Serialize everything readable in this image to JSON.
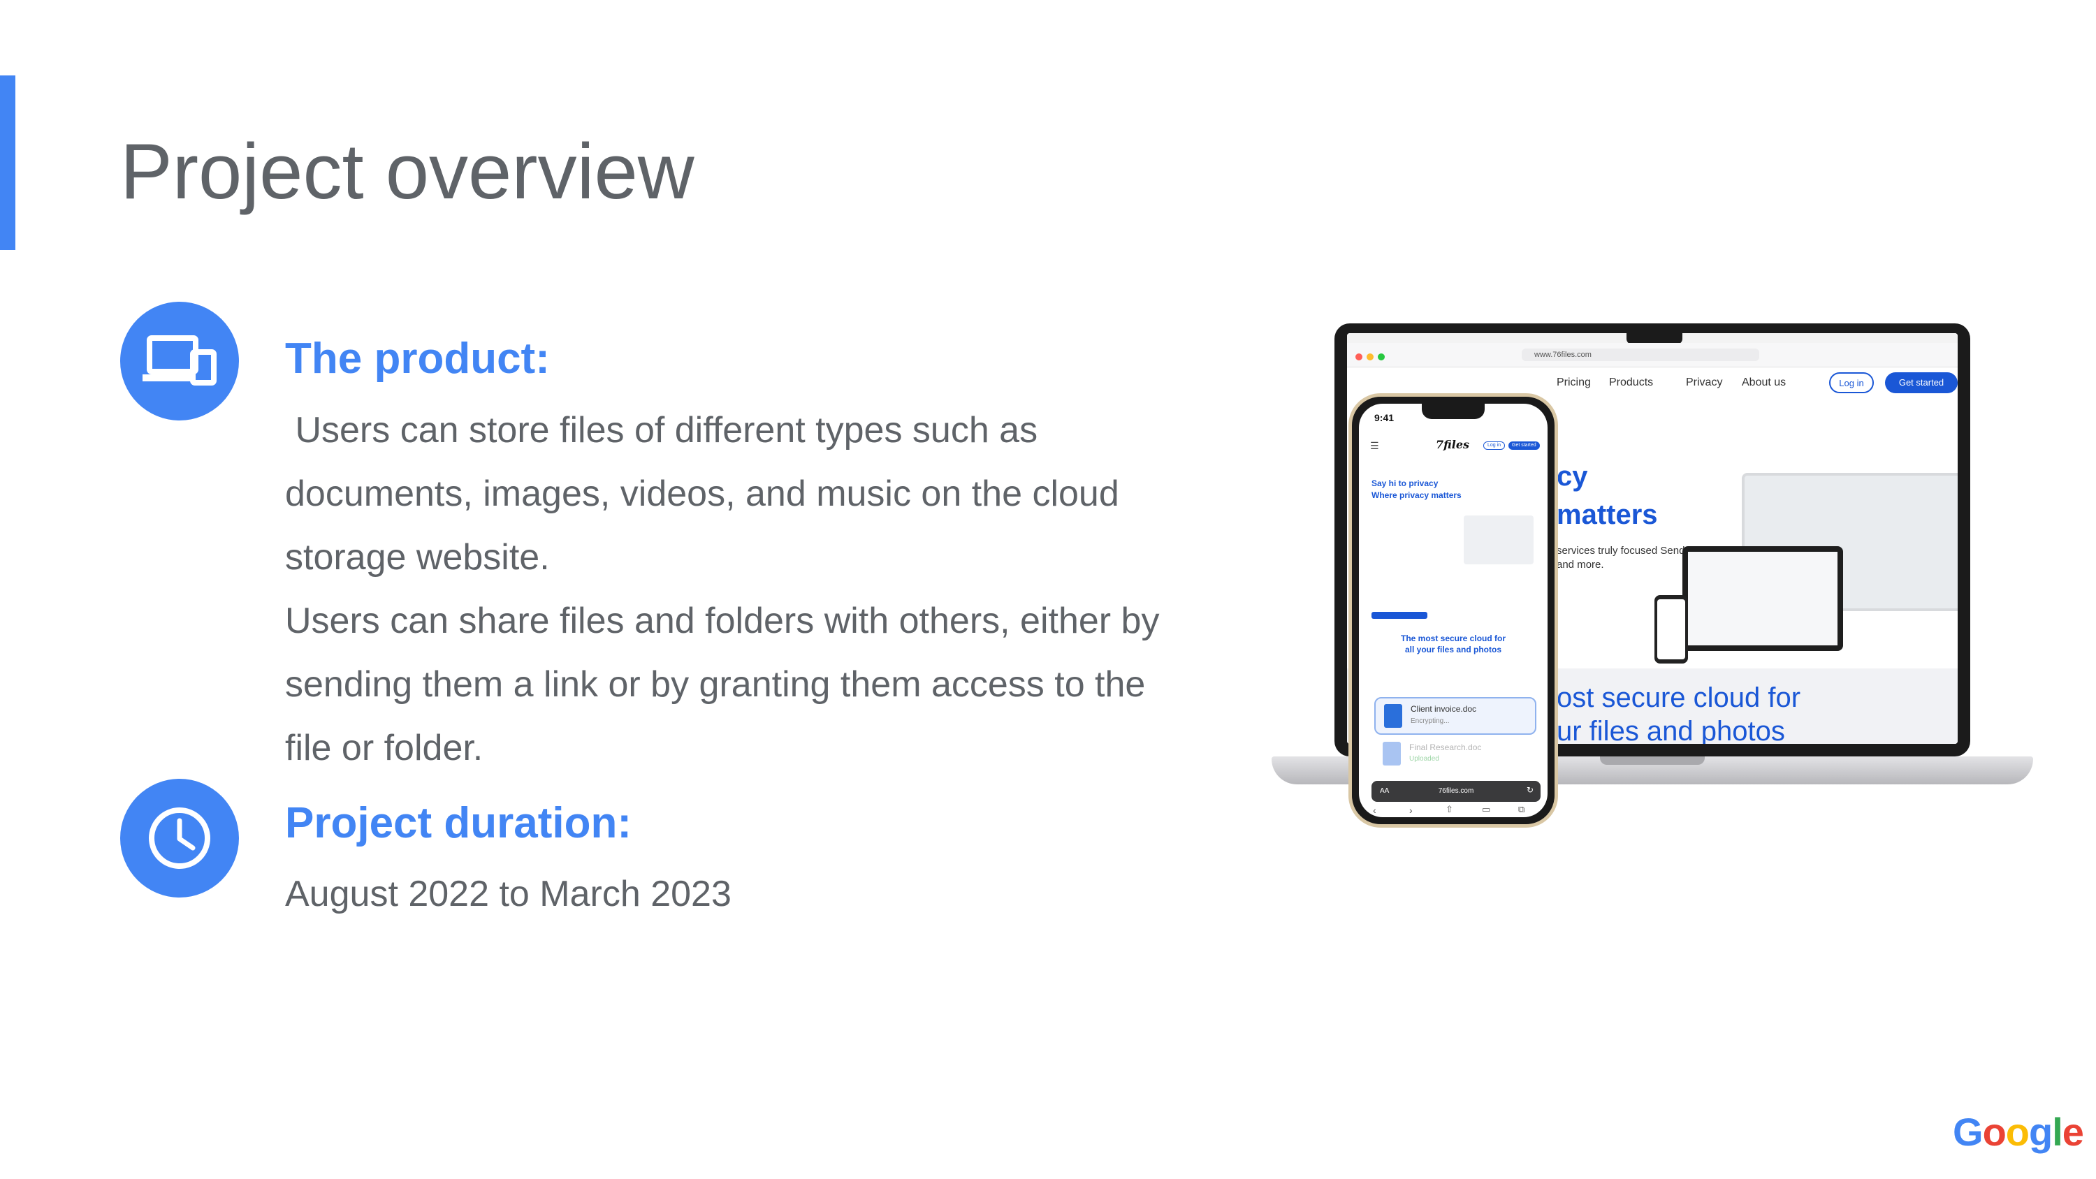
{
  "slide": {
    "title": "Project overview",
    "accent_color": "#4285f4"
  },
  "product": {
    "heading": "The product:",
    "icon": "devices-icon",
    "paragraph_1": " Users can store files of different types such as documents, images, videos, and music on the cloud storage website.",
    "paragraph_2": "Users can share files and folders with others, either by sending them a link or by granting them access to the file or folder."
  },
  "duration": {
    "heading": "Project duration:",
    "icon": "clock-icon",
    "value": "August 2022 to March 2023"
  },
  "mockup": {
    "laptop": {
      "url": "www.76files.com",
      "nav_items": [
        "Pricing",
        "Products",
        "Privacy",
        "About us"
      ],
      "login_label": "Log in",
      "cta_label": "Get started",
      "hero_line_1": "cy",
      "hero_line_2": "matters",
      "hero_sub": "services truly focused Send and more.",
      "band_line_1": "ost secure cloud for",
      "band_line_2": "ur files and photos"
    },
    "phone": {
      "time": "9:41",
      "logo": "7files",
      "login_label": "Log in",
      "cta_label": "Get started",
      "hero_line_1": "Say hi to privacy",
      "hero_line_2": "Where privacy matters",
      "section_title_1": "The most secure cloud for",
      "section_title_2": "all your files and photos",
      "file_1_name": "Client invoice.doc",
      "file_1_status": "Encrypting...",
      "file_2_name": "Final Research.doc",
      "file_2_status": "Uploaded",
      "url": "76files.com",
      "text_size_label": "AA"
    }
  },
  "brand": {
    "logo_text": "Google",
    "logo_colors": [
      "#4285f4",
      "#ea4335",
      "#fbbc05",
      "#4285f4",
      "#34a853",
      "#ea4335"
    ]
  }
}
